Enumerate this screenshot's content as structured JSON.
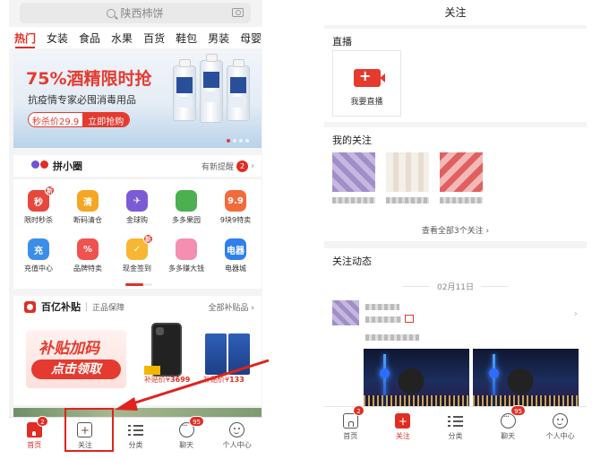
{
  "left_screen": {
    "search": {
      "placeholder": "陕西柿饼"
    },
    "category_tabs": [
      "热门",
      "女装",
      "食品",
      "水果",
      "百货",
      "鞋包",
      "男装",
      "母婴"
    ],
    "banner": {
      "title": "75%酒精限时抢",
      "subtitle": "抗疫情专家必囤消毒用品",
      "price_label": "秒杀价29.9",
      "cta": "立即抢购"
    },
    "pinxiaoquan": {
      "title": "拼小圈",
      "new_notice": "有新提醒",
      "count": "2"
    },
    "grid": [
      {
        "label": "限时秒杀",
        "icon": "alarm-clock-icon",
        "glyph": "秒",
        "color": "#e8473d",
        "badge": "新"
      },
      {
        "label": "断码清仓",
        "icon": "clearance-icon",
        "glyph": "清",
        "color": "#f5a623",
        "badge": ""
      },
      {
        "label": "金球购",
        "icon": "airplane-icon",
        "glyph": "✈",
        "color": "#7b5cd6",
        "badge": ""
      },
      {
        "label": "多多果园",
        "icon": "tree-icon",
        "glyph": "",
        "color": "#4caf50",
        "badge": ""
      },
      {
        "label": "9块9特卖",
        "icon": "nine-nine-icon",
        "glyph": "9.9",
        "color": "#f26b3a",
        "badge": ""
      },
      {
        "label": "充值中心",
        "icon": "recharge-icon",
        "glyph": "充",
        "color": "#3b8ee8",
        "badge": ""
      },
      {
        "label": "品牌特卖",
        "icon": "shopping-bag-icon",
        "glyph": "%",
        "color": "#ef5350",
        "badge": ""
      },
      {
        "label": "现金签到",
        "icon": "calendar-icon",
        "glyph": "✓",
        "color": "#f7b733",
        "badge": "新"
      },
      {
        "label": "多多赚大钱",
        "icon": "piggy-bank-icon",
        "glyph": "",
        "color": "#f48fb1",
        "badge": ""
      },
      {
        "label": "电器城",
        "icon": "appliance-icon",
        "glyph": "电器",
        "color": "#2f80ed",
        "badge": ""
      }
    ],
    "subsidy": {
      "title": "百亿补贴",
      "guarantee": "正品保障",
      "all_link": "全部补贴品",
      "headline": "补贴加码",
      "cta": "点击领取",
      "products": [
        {
          "price_prefix": "补贴价¥",
          "price": "3699"
        },
        {
          "price_prefix": "补贴价¥",
          "price": "133"
        }
      ]
    },
    "tabbar": [
      {
        "label": "首页",
        "icon": "home-icon",
        "badge": "2",
        "active": true
      },
      {
        "label": "关注",
        "icon": "follow-icon",
        "badge": "",
        "active": false
      },
      {
        "label": "分类",
        "icon": "category-icon",
        "badge": "",
        "active": false
      },
      {
        "label": "聊天",
        "icon": "chat-icon",
        "badge": "95",
        "active": false
      },
      {
        "label": "个人中心",
        "icon": "user-icon",
        "badge": "",
        "active": false
      }
    ]
  },
  "right_screen": {
    "header": "关注",
    "live": {
      "title": "直播",
      "button_label": "我要直播"
    },
    "my_follows": {
      "title": "我的关注",
      "view_all": "查看全部3个关注"
    },
    "feed": {
      "title": "关注动态",
      "date": "02月11日"
    },
    "tabbar": [
      {
        "label": "首页",
        "icon": "home-icon",
        "badge": "2",
        "active": false
      },
      {
        "label": "关注",
        "icon": "follow-icon",
        "badge": "",
        "active": true
      },
      {
        "label": "分类",
        "icon": "category-icon",
        "badge": "",
        "active": false
      },
      {
        "label": "聊天",
        "icon": "chat-icon",
        "badge": "95",
        "active": false
      },
      {
        "label": "个人中心",
        "icon": "user-icon",
        "badge": "",
        "active": false
      }
    ]
  },
  "annotation": {
    "color": "#e0231e"
  }
}
